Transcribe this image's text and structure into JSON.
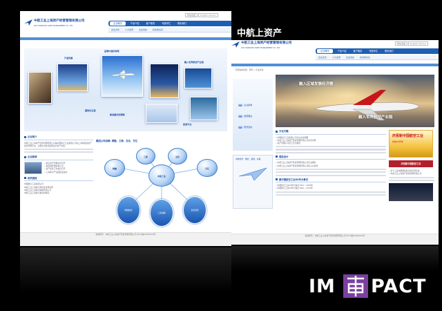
{
  "caption": "中航上资产",
  "brand": {
    "left": "IM",
    "right": "PACT"
  },
  "colors": {
    "brand_blue": "#1e5fb3",
    "accent_purple": "#7b3fa0",
    "background": "#000000"
  },
  "site": {
    "logo_cn": "中航工业上海资产经营管理有限公司",
    "logo_en": "AVIC SHANGHAI ASSET MANAGEMENT CO., LTD.",
    "top_links": [
      "网站地图",
      "English Version"
    ],
    "nav": [
      "企业概况",
      "产品介绍",
      "客户服务",
      "专题专栏",
      "联系我们"
    ],
    "subnav": [
      "企业文化",
      "人力资源",
      "企业动态",
      "投资者关系"
    ]
  },
  "left_page": {
    "banner_tiles": [
      "产品完善",
      "品牌价值的体现",
      "国际化生涯",
      "融入世界航空产业链",
      "航运模式的探索",
      "投资平台"
    ],
    "company_intro_title": "企业简介",
    "company_intro_text": "中航工业上海资产经营管理有限公司是中国航空工业集团公司在上海地区的资产经营管理平台，主要负责整合集团在沪资产资源。",
    "news_title": "企业新闻",
    "news_items": [
      "• 航空资产管理论坛召开",
      "• 集团领导视察我公司",
      "• 资产经营工作会议召开",
      "• 上海航空产业园建设启动"
    ],
    "links_title": "相关链接",
    "links": [
      "中国航空工业集团公司",
      "中航工业上海航空测控技术研究所",
      "中航工业上海航空电器有限公司",
      "中航工业上海航空发动机制造"
    ],
    "diagram_caption": "集团公司战略: 两融、三新、五化、万亿",
    "diagram_nodes": [
      "两融",
      "三新",
      "五化",
      "万亿"
    ],
    "diagram_center": "中航工业",
    "diagram_bottom": [
      "两融模式",
      "三新战略",
      "五化目标"
    ],
    "footer": "版权所有：中航工业上海资产经营管理有限公司 沪ICP备05000000号"
  },
  "right_page": {
    "breadcrumb": "您现在的位置：首页 > 企业文化",
    "banner_text_1": "融入区域发展经济圈",
    "banner_text_2": "融入世界航空产业链",
    "side_menu": [
      "企业使命",
      "经营理念",
      "愿景目标"
    ],
    "side_text": "中航标志：融合、发展、共赢",
    "sections": [
      {
        "title": "文化文稿",
        "lines": [
          "• 中国航空工业集团公司企业文化纲要",
          "• 中航工业上海资产经营管理有限公司文化手册",
          "• 资产管理公司员工行为规范"
        ]
      },
      {
        "title": "理念设计",
        "lines": [
          "• 中航工业上海资产经营管理有限公司企业理念",
          "• 中航工业上海资产经营管理有限公司核心价值观"
        ]
      },
      {
        "title": "集中国航空工业60年大事记",
        "lines": [
          "• 中国航空工业60年大事记1951—1960年",
          "• 中国航空工业60年大事记1961—1970年"
        ]
      }
    ],
    "ad_title": "庆祝新中国航空工业",
    "ad_sub": "创建60周年",
    "ad_bar": "庆祝新中国航空工业",
    "right_links": [
      "• 第十三届中国国际航空航天博览会",
      "• 中航工业上海资产经营管理有限公司"
    ],
    "footer": "版权所有：中航工业上海资产经营管理有限公司 沪ICP备05000000号"
  }
}
